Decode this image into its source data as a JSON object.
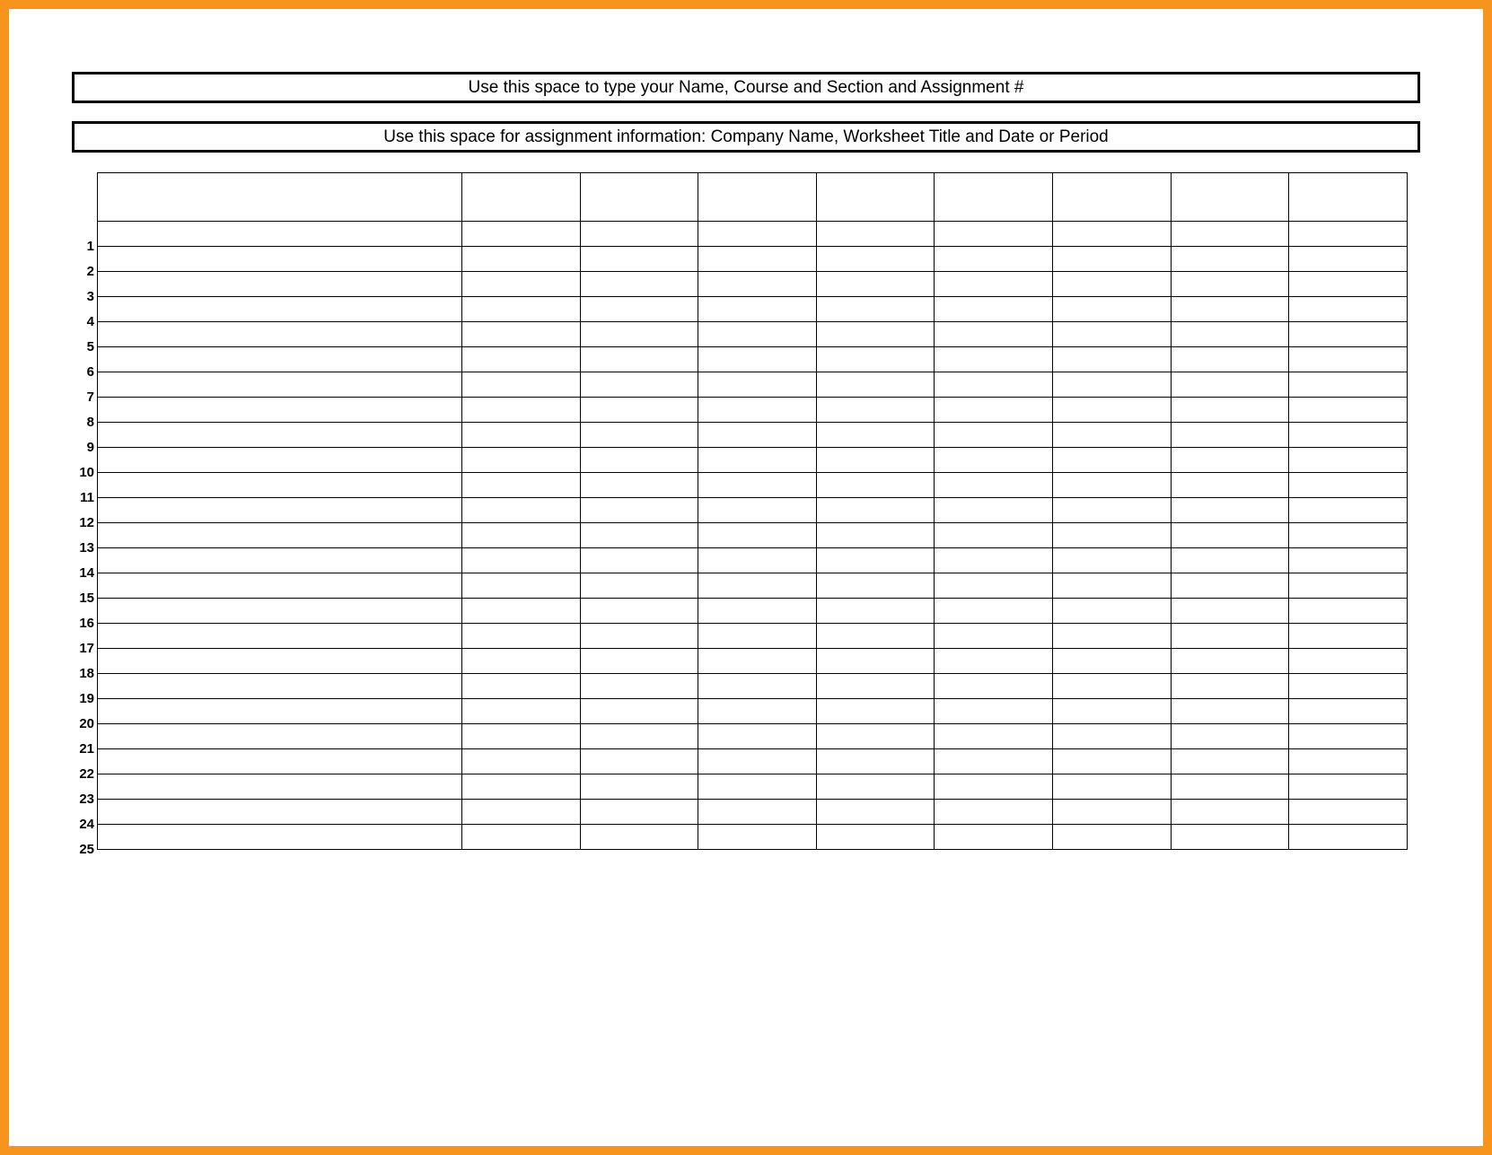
{
  "header1": "Use this space to type your Name, Course and Section and Assignment #",
  "header2": "Use this space for assignment information: Company Name, Worksheet Title and Date or Period",
  "rows": [
    "1",
    "2",
    "3",
    "4",
    "5",
    "6",
    "7",
    "8",
    "9",
    "10",
    "11",
    "12",
    "13",
    "14",
    "15",
    "16",
    "17",
    "18",
    "19",
    "20",
    "21",
    "22",
    "23",
    "24",
    "25"
  ],
  "columns": 9
}
